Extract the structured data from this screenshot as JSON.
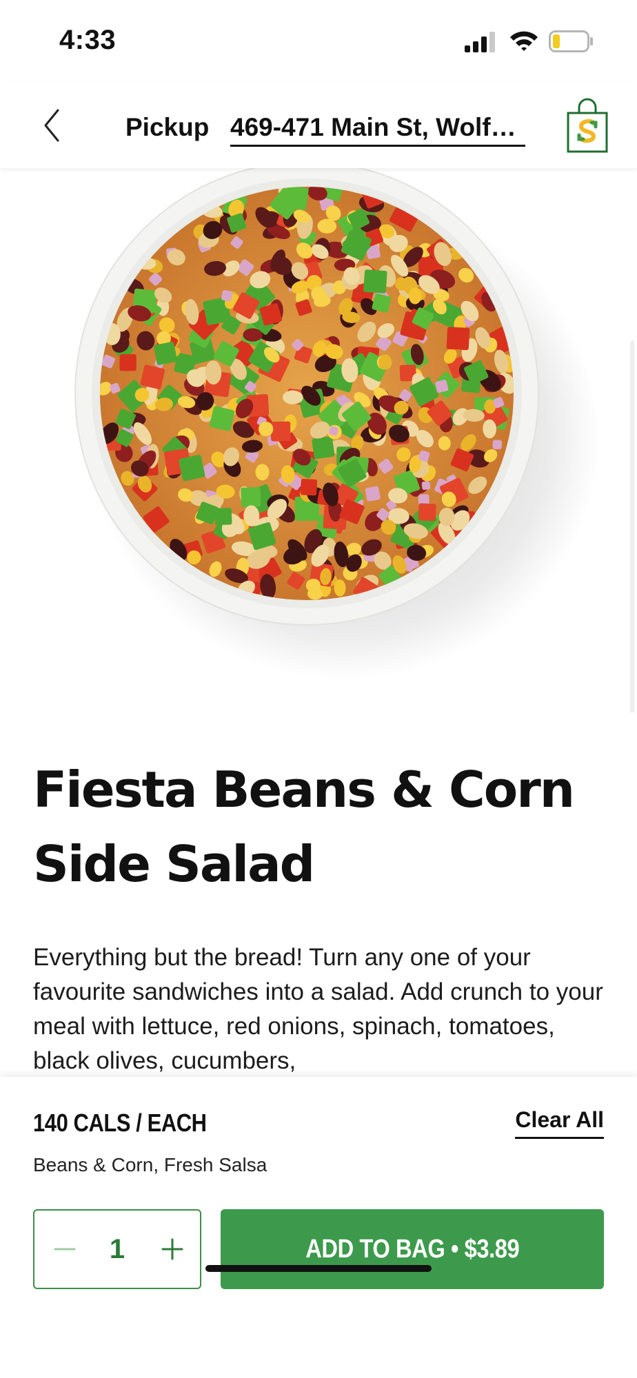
{
  "status_bar": {
    "time": "4:33"
  },
  "header": {
    "mode_label": "Pickup",
    "address": "469-471 Main St, Wolf…"
  },
  "product": {
    "title_line1": "Fiesta Beans & Corn",
    "title_line2": "Side Salad",
    "description": "Everything but the bread! Turn any one of your favourite sandwiches into a salad. Add crunch to your meal with lettuce, red onions, spinach, tomatoes, black olives, cucumbers,"
  },
  "order_panel": {
    "calories": "140 CALS / EACH",
    "clear_all_label": "Clear All",
    "ingredients": "Beans & Corn, Fresh Salsa",
    "quantity": "1",
    "add_to_bag_label": "ADD TO BAG • $3.89"
  },
  "icons": {
    "back": "chevron-left-icon",
    "bag": "shopping-bag-icon",
    "minus": "minus-icon",
    "plus": "plus-icon"
  },
  "colors": {
    "brand_green": "#3d9a4c",
    "stepper_green": "#2c7a38",
    "bag_yellow": "#f2b824"
  }
}
